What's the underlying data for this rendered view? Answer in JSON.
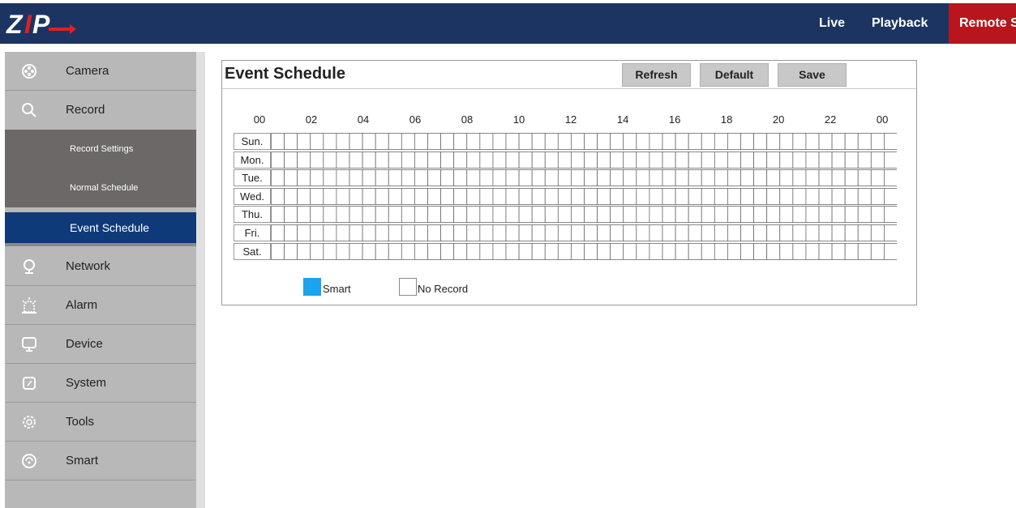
{
  "topbar": {
    "logo_text": "ZIP",
    "nav": [
      {
        "label": "Live"
      },
      {
        "label": "Playback"
      },
      {
        "label": "Remote S"
      }
    ]
  },
  "sidebar": {
    "items": [
      {
        "label": "Camera",
        "icon": "camera-icon"
      },
      {
        "label": "Record",
        "icon": "search-icon"
      },
      {
        "label": "Network",
        "icon": "network-icon"
      },
      {
        "label": "Alarm",
        "icon": "alarm-icon"
      },
      {
        "label": "Device",
        "icon": "device-icon"
      },
      {
        "label": "System",
        "icon": "system-icon"
      },
      {
        "label": "Tools",
        "icon": "gear-icon"
      },
      {
        "label": "Smart",
        "icon": "smart-icon"
      }
    ],
    "record_sub": [
      {
        "label": "Record Settings"
      },
      {
        "label": "Normal Schedule"
      },
      {
        "label": "Event Schedule",
        "active": true
      }
    ]
  },
  "panel": {
    "title": "Event Schedule",
    "buttons": {
      "refresh": "Refresh",
      "default": "Default",
      "save": "Save"
    },
    "hours": [
      "00",
      "02",
      "04",
      "06",
      "08",
      "10",
      "12",
      "14",
      "16",
      "18",
      "20",
      "22",
      "00"
    ],
    "days": [
      "Sun.",
      "Mon.",
      "Tue.",
      "Wed.",
      "Thu.",
      "Fri.",
      "Sat."
    ],
    "slots_per_day": 48,
    "legend": {
      "smart": "Smart",
      "no_record": "No Record"
    }
  },
  "colors": {
    "topbar": "#1c3461",
    "remote_tab": "#b8151c",
    "active_sub": "#0f3a7a",
    "smart": "#1aa3ee"
  }
}
